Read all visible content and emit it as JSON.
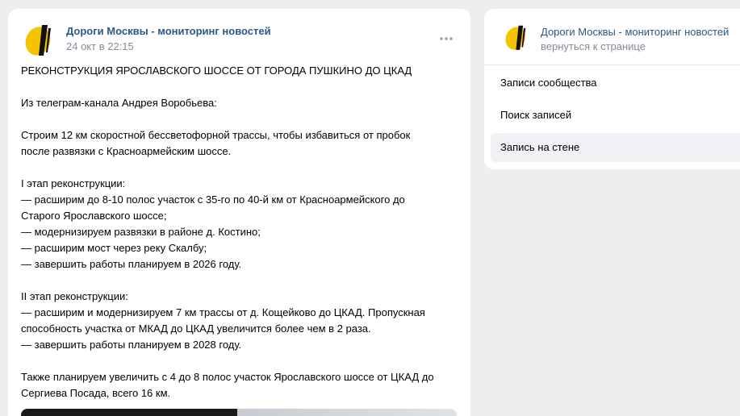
{
  "post": {
    "author": "Дороги Москвы - мониторинг новостей",
    "date": "24 окт в 22:15",
    "title": "РЕКОНСТРУКЦИЯ ЯРОСЛАВСКОГО ШОССЕ ОТ ГОРОДА ПУШКИНО ДО ЦКАД",
    "source": "Из телеграм-канала Андрея Воробьева:",
    "intro_1": "Строим 12 км скоростной бессветофорной трассы, чтобы избавиться от пробок",
    "intro_2": "после развязки с Красноармейским шоссе.",
    "stage1_head": "I этап реконструкции:",
    "stage1_l1": "— расширим до 8-10 полос участок с 35-го по 40-й км от Красноармейского до",
    "stage1_l2": "Старого Ярославского шоссе;",
    "stage1_l3": "— модернизируем развязки в районе д. Костино;",
    "stage1_l4": "— расширим мост через реку Скалбу;",
    "stage1_l5": "— завершить работы планируем в 2026 году.",
    "stage2_head": "II этап реконструкции:",
    "stage2_l1": "— расширим и модернизируем 7 км трассы от д. Кощейково до ЦКАД. Пропускная",
    "stage2_l2": "способность участка от МКАД до ЦКАД увеличится более чем в 2 раза.",
    "stage2_l3": "— завершить работы планируем в 2028 году.",
    "outro_1": "Также планируем увеличить с 4 до 8 полос участок Ярославского шоссе от ЦКАД до",
    "outro_2": "Сергиева Посада, всего 16 км."
  },
  "sidebar": {
    "title": "Дороги Москвы - мониторинг новостей",
    "back_link": "вернуться к странице",
    "items": [
      {
        "label": "Записи сообщества"
      },
      {
        "label": "Поиск записей"
      },
      {
        "label": "Запись на стене"
      }
    ]
  },
  "colors": {
    "link": "#2a5885",
    "muted": "#818c99",
    "logo_yellow": "#f5c400",
    "logo_black": "#111111"
  },
  "icons": {
    "avatar": "logo-icon",
    "more": "more-dots-icon"
  }
}
